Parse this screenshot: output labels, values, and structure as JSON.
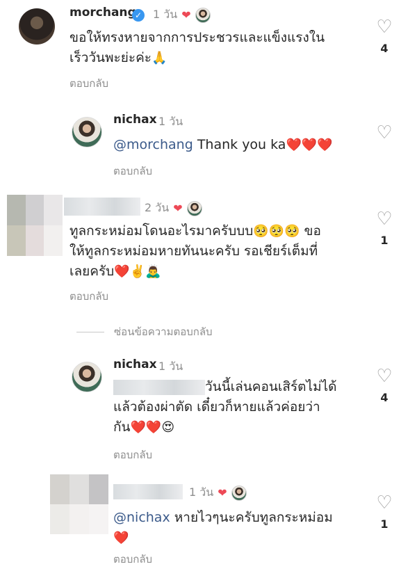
{
  "comments": [
    {
      "username": "morchang",
      "time": "1 วัน",
      "text": "ขอให้ทรงหายจากการประชวรและแข็งแรงใน",
      "text2": "เร็ววันพะย่ะค่ะ",
      "emoji": "🙏",
      "reply_label": "ตอบกลับ",
      "likes": "4"
    },
    {
      "username": "nichax",
      "time": "1 วัน",
      "mention": "@morchang",
      "text": "Thank you ka",
      "emoji": "❤️❤️❤️",
      "reply_label": "ตอบกลับ",
      "likes": ""
    },
    {
      "username": "",
      "time": "2 วัน",
      "text": "ทูลกระหม่อมโดนอะไรมาครับบบ",
      "emoji1": "🥺🥺🥺",
      "text_b": " ขอ",
      "text2": "ให้ทูลกระหม่อมหายทันนะครับ รอเชียร์เต็มที่",
      "text3": "เลยครับ",
      "emoji3": "❤️✌️🙇‍♂️",
      "reply_label": "ตอบกลับ",
      "likes": "1"
    },
    {
      "hide_label": "ซ่อนข้อความตอบกลับ"
    },
    {
      "username": "nichax",
      "time": "1 วัน",
      "text": "วันนี้เล่นคอนเสิร์ตไม่ได้",
      "text2": "แล้วต้องผ่าตัด เดี๋ยวก็หายแล้วค่อยว่า",
      "text3": "กัน",
      "emoji3": "❤️❤️😍",
      "reply_label": "ตอบกลับ",
      "likes": "4"
    },
    {
      "username": "",
      "time": "1 วัน",
      "mention": "@nichax",
      "text": "หายไวๆนะครับทูลกระหม่อม",
      "emoji2": "❤️",
      "reply_label": "ตอบกลับ",
      "likes": "1"
    }
  ]
}
